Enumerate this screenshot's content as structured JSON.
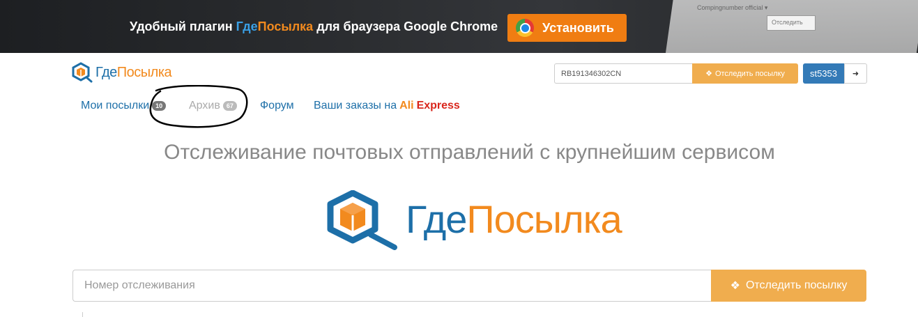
{
  "banner": {
    "text_prefix": "Удобный плагин ",
    "brand_part1": "Где",
    "brand_part2": "Посылка",
    "text_suffix": " для браузера Google Chrome",
    "install_label": "Установить",
    "bg_line": "Compingnumber official ▾",
    "bg_button": "Отследить"
  },
  "header": {
    "logo_part1": "Где",
    "logo_part2": "Посылка",
    "track_value": "RB191346302CN",
    "track_button": "Отследить посылку",
    "username": "st5353"
  },
  "nav": {
    "my_parcels": "Мои посылки",
    "my_parcels_count": "10",
    "archive": "Архив",
    "archive_count": "67",
    "forum": "Форум",
    "orders_prefix": "Ваши заказы на ",
    "ali_a": "Ali",
    "ali_b": "Express"
  },
  "hero": {
    "title": "Отслеживание почтовых отправлений с крупнейшим сервисом",
    "logo_part1": "Где",
    "logo_part2": "Посылка"
  },
  "search": {
    "placeholder": "Номер отслеживания",
    "button": "Отследить посылку"
  },
  "colors": {
    "brand_blue": "#1d6fa8",
    "brand_orange": "#f28a1e",
    "button_orange": "#f0ad4e",
    "user_blue": "#337ab7"
  }
}
